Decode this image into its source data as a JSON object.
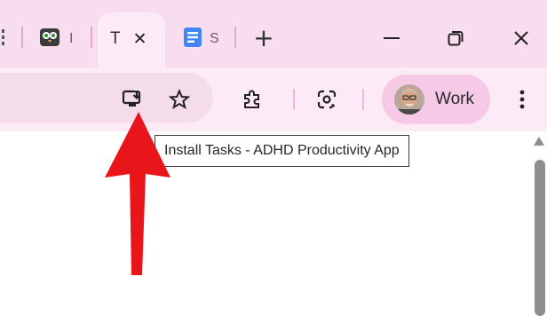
{
  "tabs": [
    {
      "label": "!"
    },
    {
      "label": "I"
    },
    {
      "label": "T"
    },
    {
      "label": "S"
    }
  ],
  "active_tab": {
    "title": "T",
    "close_symbol": "✕"
  },
  "new_tab_symbol": "+",
  "window_controls": {
    "minimize": "—",
    "restore": "❐",
    "close": "✕"
  },
  "profile": {
    "name": "Work"
  },
  "tooltip": {
    "text": "Install Tasks - ADHD Productivity App"
  },
  "icons": [
    "page-icon",
    "owl-icon",
    "docs-icon",
    "install-app-icon",
    "bookmark-star-icon",
    "extensions-icon",
    "google-lens-icon",
    "menu-icon",
    "annotation-arrow-icon"
  ],
  "colors": {
    "tabstrip": "#f8dcef",
    "toolbar": "#fceaf6",
    "profile_chip": "#f6c9e6",
    "arrow": "#e8161b",
    "tab_separator": "#e6a7cf",
    "docs_blue": "#4285f4"
  }
}
